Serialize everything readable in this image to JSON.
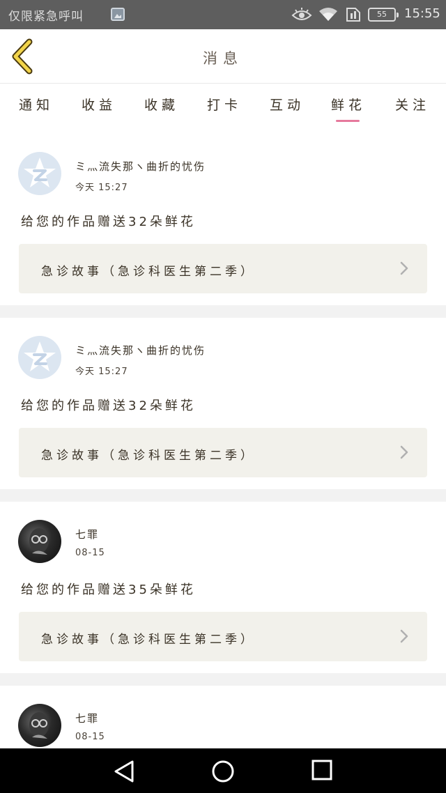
{
  "statusbar": {
    "carrier": "仅限紧急呼叫",
    "battery": "55",
    "time": "15:55"
  },
  "header": {
    "title": "消息"
  },
  "tabs": [
    {
      "label": "通知"
    },
    {
      "label": "收益"
    },
    {
      "label": "收藏"
    },
    {
      "label": "打卡"
    },
    {
      "label": "互动"
    },
    {
      "label": "鲜花"
    },
    {
      "label": "关注"
    }
  ],
  "active_tab": "鲜花",
  "colors": {
    "accent": "#e6799c",
    "divider": "#f2f2f2",
    "card_link_bg": "#f2f1eb"
  },
  "messages": [
    {
      "username": "ミ灬流失那ヽ曲折的忧伤",
      "time": "今天 15:27",
      "text": "给您的作品赠送32朵鲜花",
      "work_title": "急诊故事（急诊科医生第二季）"
    },
    {
      "username": "ミ灬流失那ヽ曲折的忧伤",
      "time": "今天 15:27",
      "text": "给您的作品赠送32朵鲜花",
      "work_title": "急诊故事（急诊科医生第二季）"
    },
    {
      "username": "七罪",
      "time": "08-15",
      "text": "给您的作品赠送35朵鲜花",
      "work_title": "急诊故事（急诊科医生第二季）"
    },
    {
      "username": "七罪",
      "time": "08-15"
    }
  ]
}
